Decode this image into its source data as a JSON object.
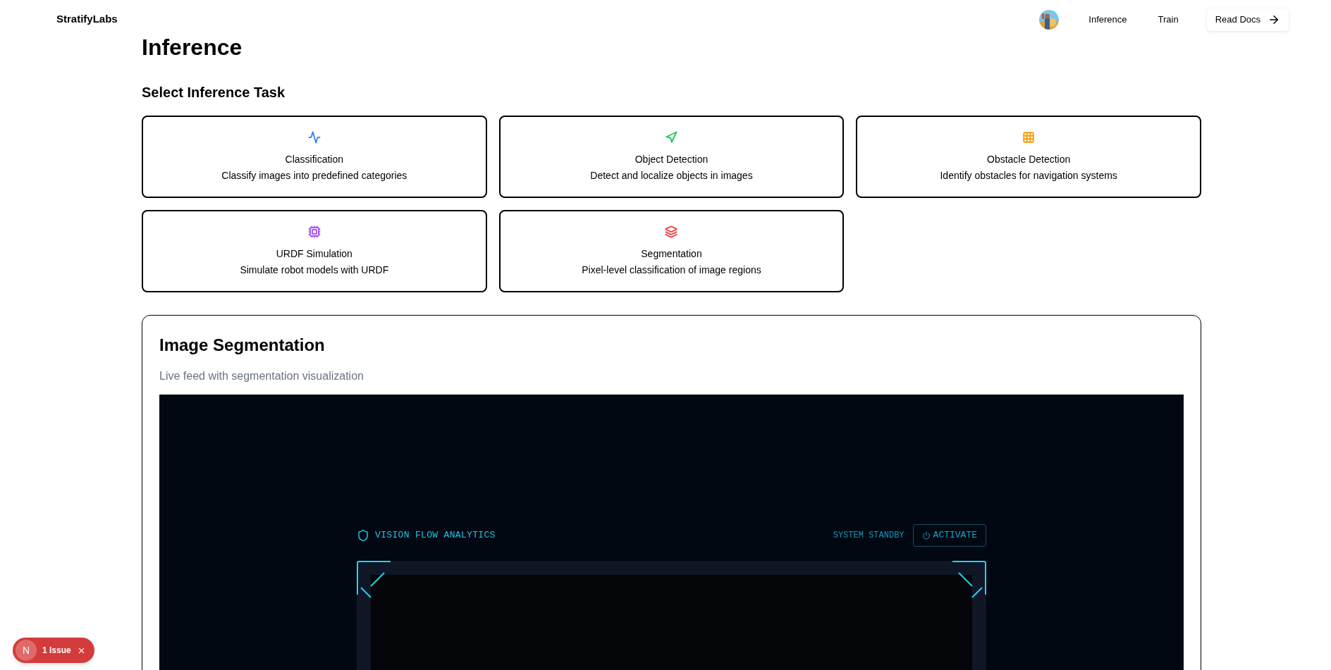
{
  "header": {
    "brand": "StratifyLabs",
    "nav": [
      {
        "label": "Inference"
      },
      {
        "label": "Train"
      }
    ],
    "docs_button": "Read Docs"
  },
  "page_title": "Inference",
  "task_section": {
    "title": "Select Inference Task",
    "tasks": [
      {
        "kind": "activity",
        "color": "#3b82f6",
        "title": "Classification",
        "description": "Classify images into predefined categories"
      },
      {
        "kind": "navigation",
        "color": "#22c55e",
        "title": "Object Detection",
        "description": "Detect and localize objects in images"
      },
      {
        "kind": "grid",
        "color": "#f59e0b",
        "title": "Obstacle Detection",
        "description": "Identify obstacles for navigation systems"
      },
      {
        "kind": "cpu",
        "color": "#a855f7",
        "title": "URDF Simulation",
        "description": "Simulate robot models with URDF"
      },
      {
        "kind": "layers",
        "color": "#ef4444",
        "title": "Segmentation",
        "description": "Pixel-level classification of image regions"
      }
    ]
  },
  "panel": {
    "title": "Image Segmentation",
    "subtitle": "Live feed with segmentation visualization",
    "viewer": {
      "title": "VISION FLOW ANALYTICS",
      "status": "SYSTEM STANDBY",
      "button": "ACTIVATE"
    }
  },
  "issue_badge": {
    "letter": "N",
    "label": "1 Issue"
  }
}
